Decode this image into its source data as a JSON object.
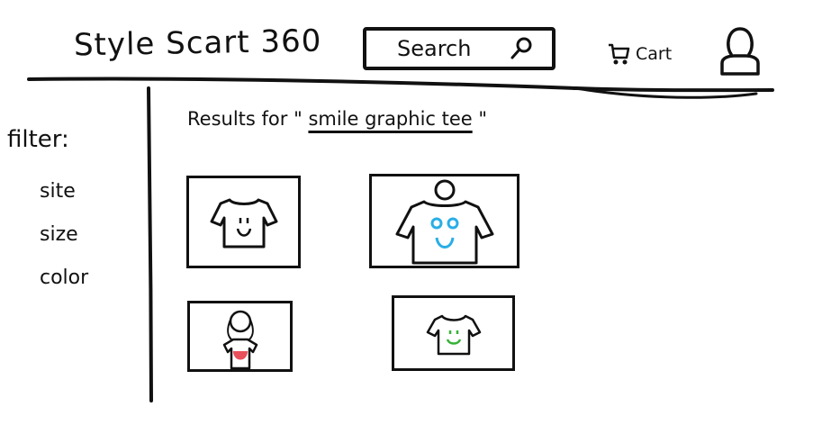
{
  "header": {
    "brand": "Style Scart 360",
    "search": {
      "label": "Search",
      "icon": "search-icon"
    },
    "cart": {
      "label": "Cart",
      "icon": "cart-icon"
    },
    "account": {
      "icon": "user-icon"
    }
  },
  "filters": {
    "title": "filter:",
    "options": [
      "site",
      "size",
      "color"
    ]
  },
  "results": {
    "prefix": "Results for",
    "open_quote": "\"",
    "query": "smile graphic tee",
    "close_quote": "\""
  },
  "products": [
    {
      "image": "tshirt-smile-icon",
      "accent": "#111111"
    },
    {
      "image": "model-tshirt-blue-smile-icon",
      "accent": "#29aee6"
    },
    {
      "image": "person-red-shirt-icon",
      "accent": "#e8505b"
    },
    {
      "image": "tshirt-green-smile-icon",
      "accent": "#36b236"
    }
  ]
}
